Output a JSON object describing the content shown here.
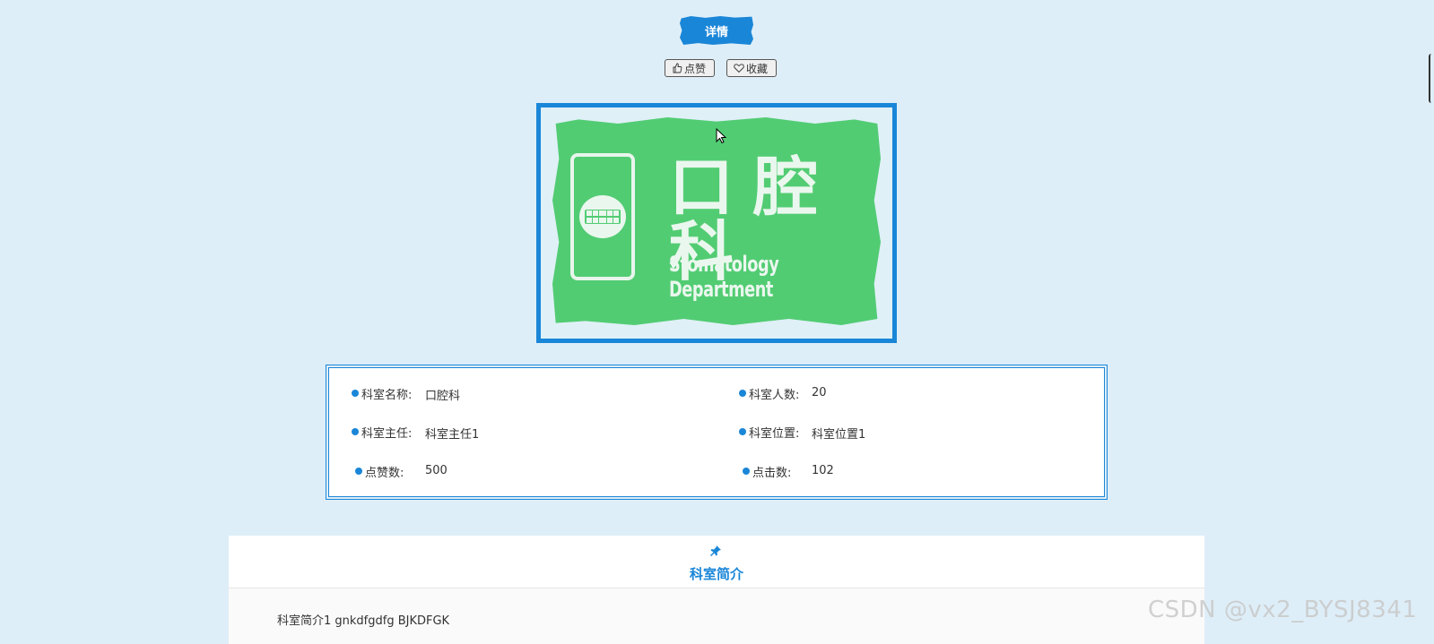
{
  "header": {
    "title": "详情"
  },
  "actions": {
    "like_label": "点赞",
    "favorite_label": "收藏"
  },
  "image": {
    "sign_cn": "口腔科",
    "sign_en": "Stomatology Department"
  },
  "info": {
    "name_label": "科室名称:",
    "name_value": "口腔科",
    "count_label": "科室人数:",
    "count_value": "20",
    "director_label": "科室主任:",
    "director_value": "科室主任1",
    "location_label": "科室位置:",
    "location_value": "科室位置1",
    "likes_label": "点赞数:",
    "likes_value": "500",
    "clicks_label": "点击数:",
    "clicks_value": "102"
  },
  "intro": {
    "title": "科室简介",
    "text": "科室简介1 gnkdfgdfg BJKDFGK"
  },
  "watermark": "CSDN @vx2_BYSJ8341",
  "colors": {
    "accent": "#1a86d8",
    "background": "#deeef8",
    "sign_green": "#52cc73"
  }
}
